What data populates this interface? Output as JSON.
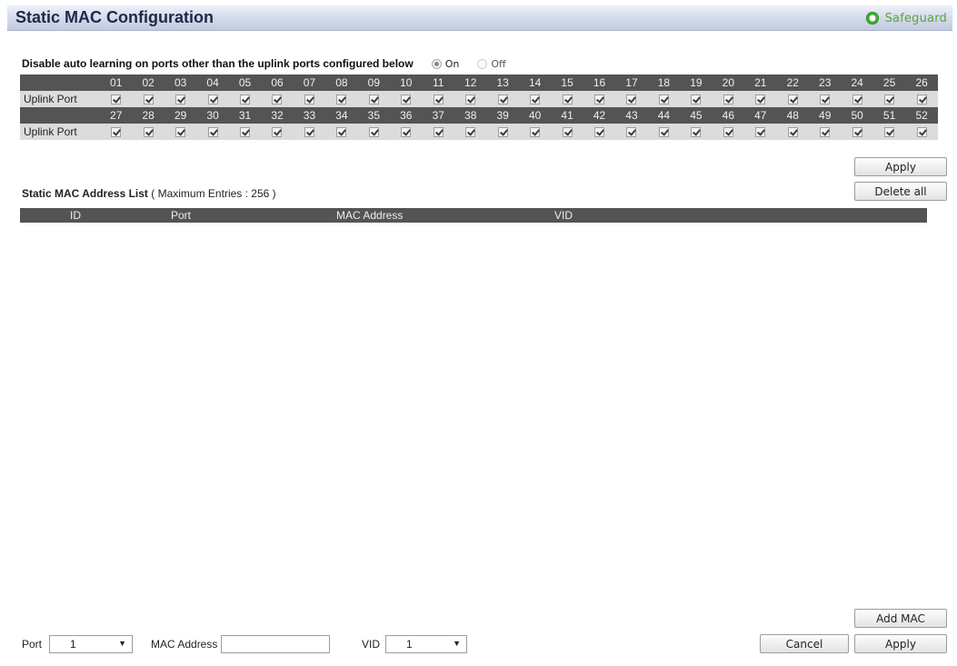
{
  "header": {
    "title": "Static MAC Configuration",
    "safeguard_label": "Safeguard"
  },
  "autolearn": {
    "label": "Disable auto learning on ports other than the uplink ports configured below",
    "on_label": "On",
    "off_label": "Off",
    "selected": "On"
  },
  "port_table": {
    "row_label": "Uplink Port",
    "rows": [
      {
        "ports": [
          "01",
          "02",
          "03",
          "04",
          "05",
          "06",
          "07",
          "08",
          "09",
          "10",
          "11",
          "12",
          "13",
          "14",
          "15",
          "16",
          "17",
          "18",
          "19",
          "20",
          "21",
          "22",
          "23",
          "24",
          "25",
          "26"
        ]
      },
      {
        "ports": [
          "27",
          "28",
          "29",
          "30",
          "31",
          "32",
          "33",
          "34",
          "35",
          "36",
          "37",
          "38",
          "39",
          "40",
          "41",
          "42",
          "43",
          "44",
          "45",
          "46",
          "47",
          "48",
          "49",
          "50",
          "51",
          "52"
        ]
      }
    ],
    "all_checked": true
  },
  "buttons": {
    "apply_top": "Apply",
    "delete_all": "Delete all",
    "add_mac": "Add MAC",
    "cancel": "Cancel",
    "apply_bottom": "Apply"
  },
  "mac_list": {
    "title": "Static MAC Address List",
    "subtitle": "( Maximum Entries : 256 )",
    "columns": [
      "ID",
      "Port",
      "MAC Address",
      "VID"
    ],
    "rows": []
  },
  "form": {
    "port_label": "Port",
    "port_value": "1",
    "mac_label": "MAC Address",
    "mac_value": "",
    "vid_label": "VID",
    "vid_value": "1"
  }
}
